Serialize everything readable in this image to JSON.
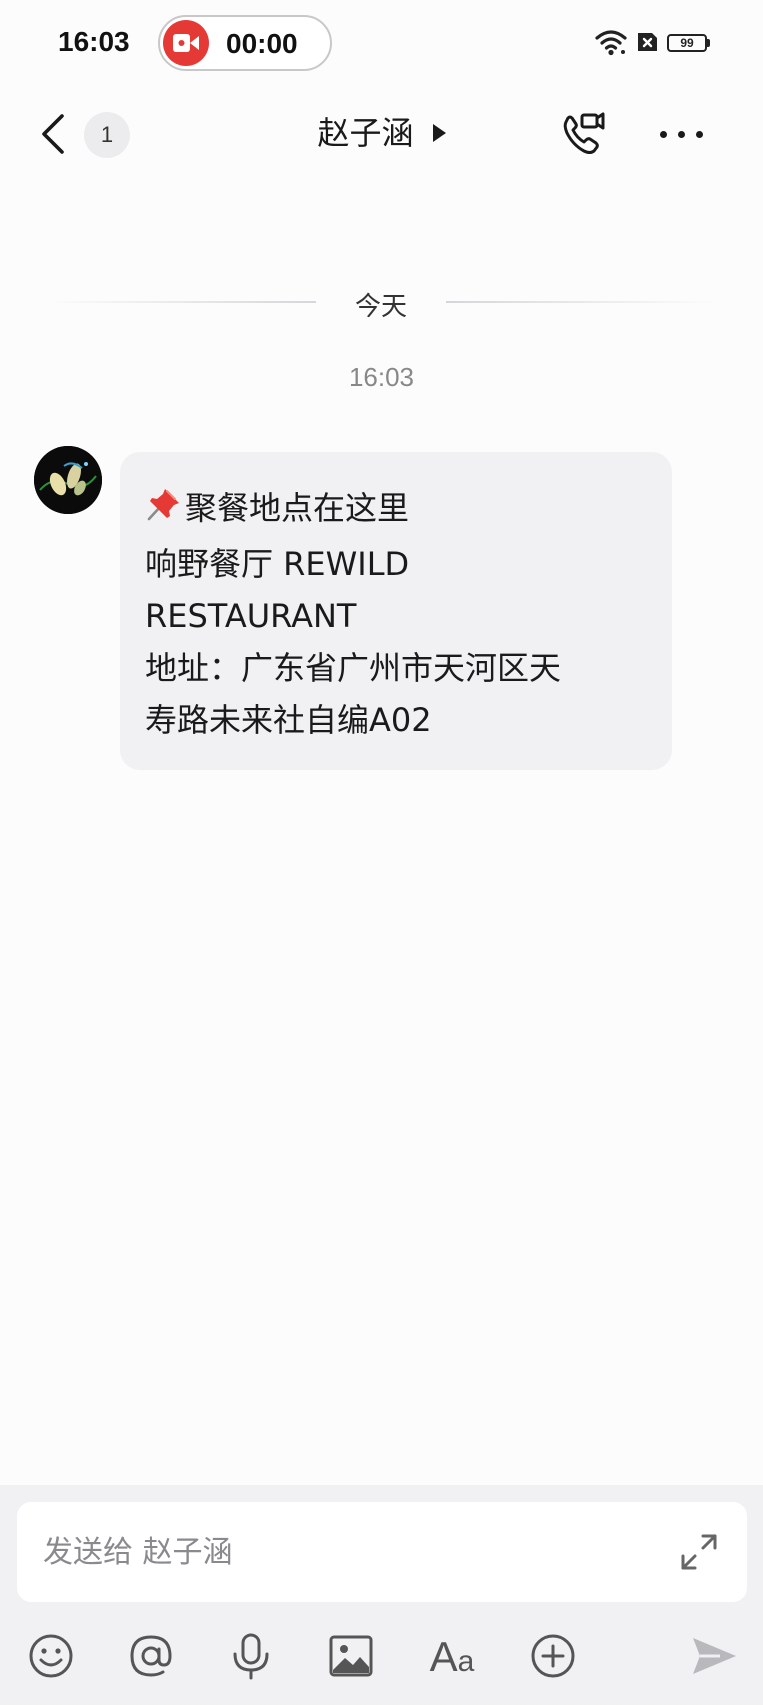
{
  "status_bar": {
    "time": "16:03",
    "recording_time": "00:00",
    "battery_level": "99",
    "icons": [
      "wifi-icon",
      "sim-off-icon",
      "battery-icon"
    ]
  },
  "nav": {
    "unread_count": "1",
    "title": "赵子涵",
    "icons": [
      "back-chevron-icon",
      "title-arrow-icon",
      "phone-video-call-icon",
      "more-icon"
    ]
  },
  "conversation": {
    "date_divider": "今天",
    "message_time": "16:03",
    "message": {
      "sender_avatar": "avatar",
      "lines": [
        "聚餐地点在这里",
        "响野餐厅 REWILD",
        "RESTAURANT",
        "地址：广东省广州市天河区天",
        "寿路未来社自编A02"
      ],
      "leading_emoji": "pushpin-icon"
    }
  },
  "composer": {
    "placeholder": "发送给 赵子涵",
    "value": "",
    "toolbar": [
      "emoji-icon",
      "mention-icon",
      "microphone-icon",
      "image-icon",
      "text-format-icon",
      "plus-icon",
      "send-icon"
    ],
    "format_label_big": "A",
    "format_label_small": "a"
  },
  "colors": {
    "background": "#fcfcfd",
    "bubble": "#f1f1f3",
    "record": "#e53935",
    "muted_text": "#888888",
    "icon": "#555555"
  }
}
